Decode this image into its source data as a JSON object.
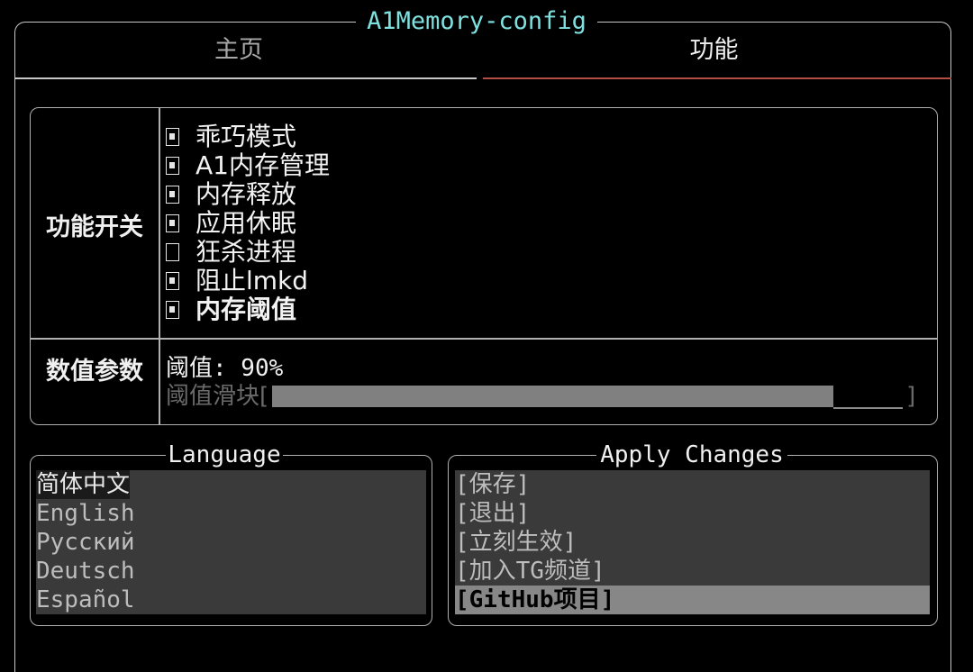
{
  "app": {
    "title": "A1Memory-config"
  },
  "tabs": [
    {
      "label": "主页",
      "active": false
    },
    {
      "label": "功能",
      "active": true
    }
  ],
  "features": {
    "section_label": "功能开关",
    "items": [
      {
        "label": "乖巧模式",
        "checked": true,
        "bold": false
      },
      {
        "label": "A1内存管理",
        "checked": true,
        "bold": false
      },
      {
        "label": "内存释放",
        "checked": true,
        "bold": false
      },
      {
        "label": "应用休眠",
        "checked": true,
        "bold": false
      },
      {
        "label": "狂杀进程",
        "checked": false,
        "bold": false
      },
      {
        "label": "阻止lmkd",
        "checked": true,
        "bold": false
      },
      {
        "label": "内存阈值",
        "checked": true,
        "bold": true
      }
    ]
  },
  "params": {
    "section_label": "数值参数",
    "threshold_text": "阈值: 90%",
    "slider_label": "阈值滑块[",
    "slider_end": "]",
    "slider_value": 0.89
  },
  "language": {
    "title": "Language",
    "items": [
      "简体中文",
      "English",
      "Русский",
      "Deutsch",
      "Español"
    ],
    "selected_index": 0
  },
  "apply": {
    "title": "Apply Changes",
    "items": [
      "[保存]",
      "[退出]",
      "[立刻生效]",
      "[加入TG频道]",
      "[GitHub项目]"
    ],
    "focused_index": 4
  },
  "colors": {
    "title": "#7fe0e0",
    "active_tab_underline": "#b34f45",
    "list_bg": "#3a3a3a",
    "highlight_bg": "#878787",
    "slider_fill": "#808080"
  }
}
